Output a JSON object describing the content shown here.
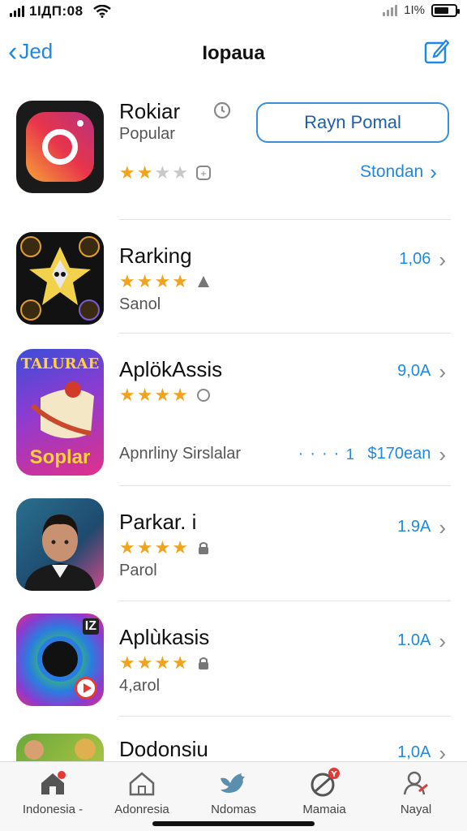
{
  "status_bar": {
    "time": "1ΙДП:08",
    "battery_pct": "1Ι%",
    "battery_level": 0.7
  },
  "nav": {
    "back_label": "Jed",
    "title": "Ιopaua",
    "edit_icon": "compose-icon"
  },
  "featured": {
    "history_icon": "clock-icon",
    "button_label": "Rayn Pomal",
    "link_label": "Stondan"
  },
  "apps": [
    {
      "name": "Rokiar",
      "subtitle": "Popular",
      "stars": 2,
      "price": ""
    },
    {
      "name": "Rarking",
      "subtitle": "Sanol",
      "stars": 4,
      "price": "1,06"
    },
    {
      "name": "AplökAssis",
      "subtitle": "Apnrliny Sirslalar",
      "stars": 4,
      "price": "9,0A",
      "icon_text_top": "TALURAE",
      "icon_text_bottom": "Soplar",
      "extra_price": "$170ean",
      "dots": "‧ ‧ ‧ ‧ 1"
    },
    {
      "name": "Parkar. i",
      "subtitle": "Parol",
      "stars": 4,
      "price": "1.9A"
    },
    {
      "name": "Aplùkasis",
      "subtitle": "4,arol",
      "stars": 4,
      "price": "1.0A",
      "icon_badge": "IZ"
    },
    {
      "name": "Dodonsiu",
      "subtitle": "",
      "stars": 0,
      "price": "1,0A"
    }
  ],
  "tabs": [
    {
      "label": "Indonesia -",
      "icon": "home-icon"
    },
    {
      "label": "Adonresia",
      "icon": "house-outline-icon"
    },
    {
      "label": "Ndomas",
      "icon": "bird-icon"
    },
    {
      "label": "Mamaia",
      "icon": "circle-badge-icon",
      "badge": "Y"
    },
    {
      "label": "Nayal",
      "icon": "person-icon"
    }
  ],
  "colors": {
    "accent": "#1e88e5",
    "star": "#f2a31b",
    "badge": "#e53935"
  }
}
